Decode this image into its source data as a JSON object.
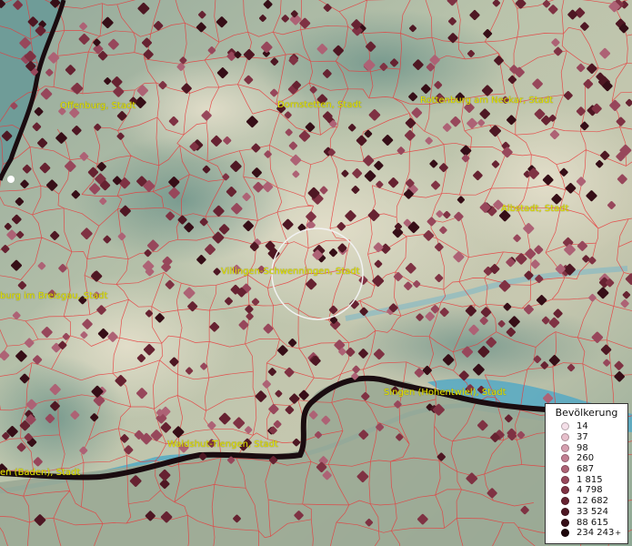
{
  "map": {
    "cities": [
      {
        "name": "Offenburg, Stadt"
      },
      {
        "name": "Dornstetten, Stadt"
      },
      {
        "name": "Rottenburg am Neckar, Stadt"
      },
      {
        "name": "Albstadt, Stadt"
      },
      {
        "name": "Villingen-Schwenningen, Stadt"
      },
      {
        "name": "burg im Breisgau, Stadt"
      },
      {
        "name": "Singen (Hohentwiel), Stadt"
      },
      {
        "name": "Waldshut-Tiengen, Stadt"
      },
      {
        "name": "en (Baden), Stadt"
      }
    ],
    "colors": {
      "border_red": "#e8393b",
      "state_border": "#1a0c10",
      "marker_dark": "#5a1e26",
      "label_yellow": "#e6e600"
    }
  },
  "legend": {
    "title": "Bevölkerung",
    "items": [
      {
        "label": "14",
        "color": "#f4dfe8"
      },
      {
        "label": "37",
        "color": "#e7c0cc"
      },
      {
        "label": "98",
        "color": "#d6a0b0"
      },
      {
        "label": "260",
        "color": "#c27f92"
      },
      {
        "label": "687",
        "color": "#ad6275"
      },
      {
        "label": "1 815",
        "color": "#97475b"
      },
      {
        "label": "4 798",
        "color": "#7f3243"
      },
      {
        "label": "12 682",
        "color": "#662231"
      },
      {
        "label": "33 524",
        "color": "#4e1723"
      },
      {
        "label": "88 615",
        "color": "#360e17"
      },
      {
        "label": "234 243",
        "color": "#1f060b"
      }
    ],
    "plus": "+"
  }
}
